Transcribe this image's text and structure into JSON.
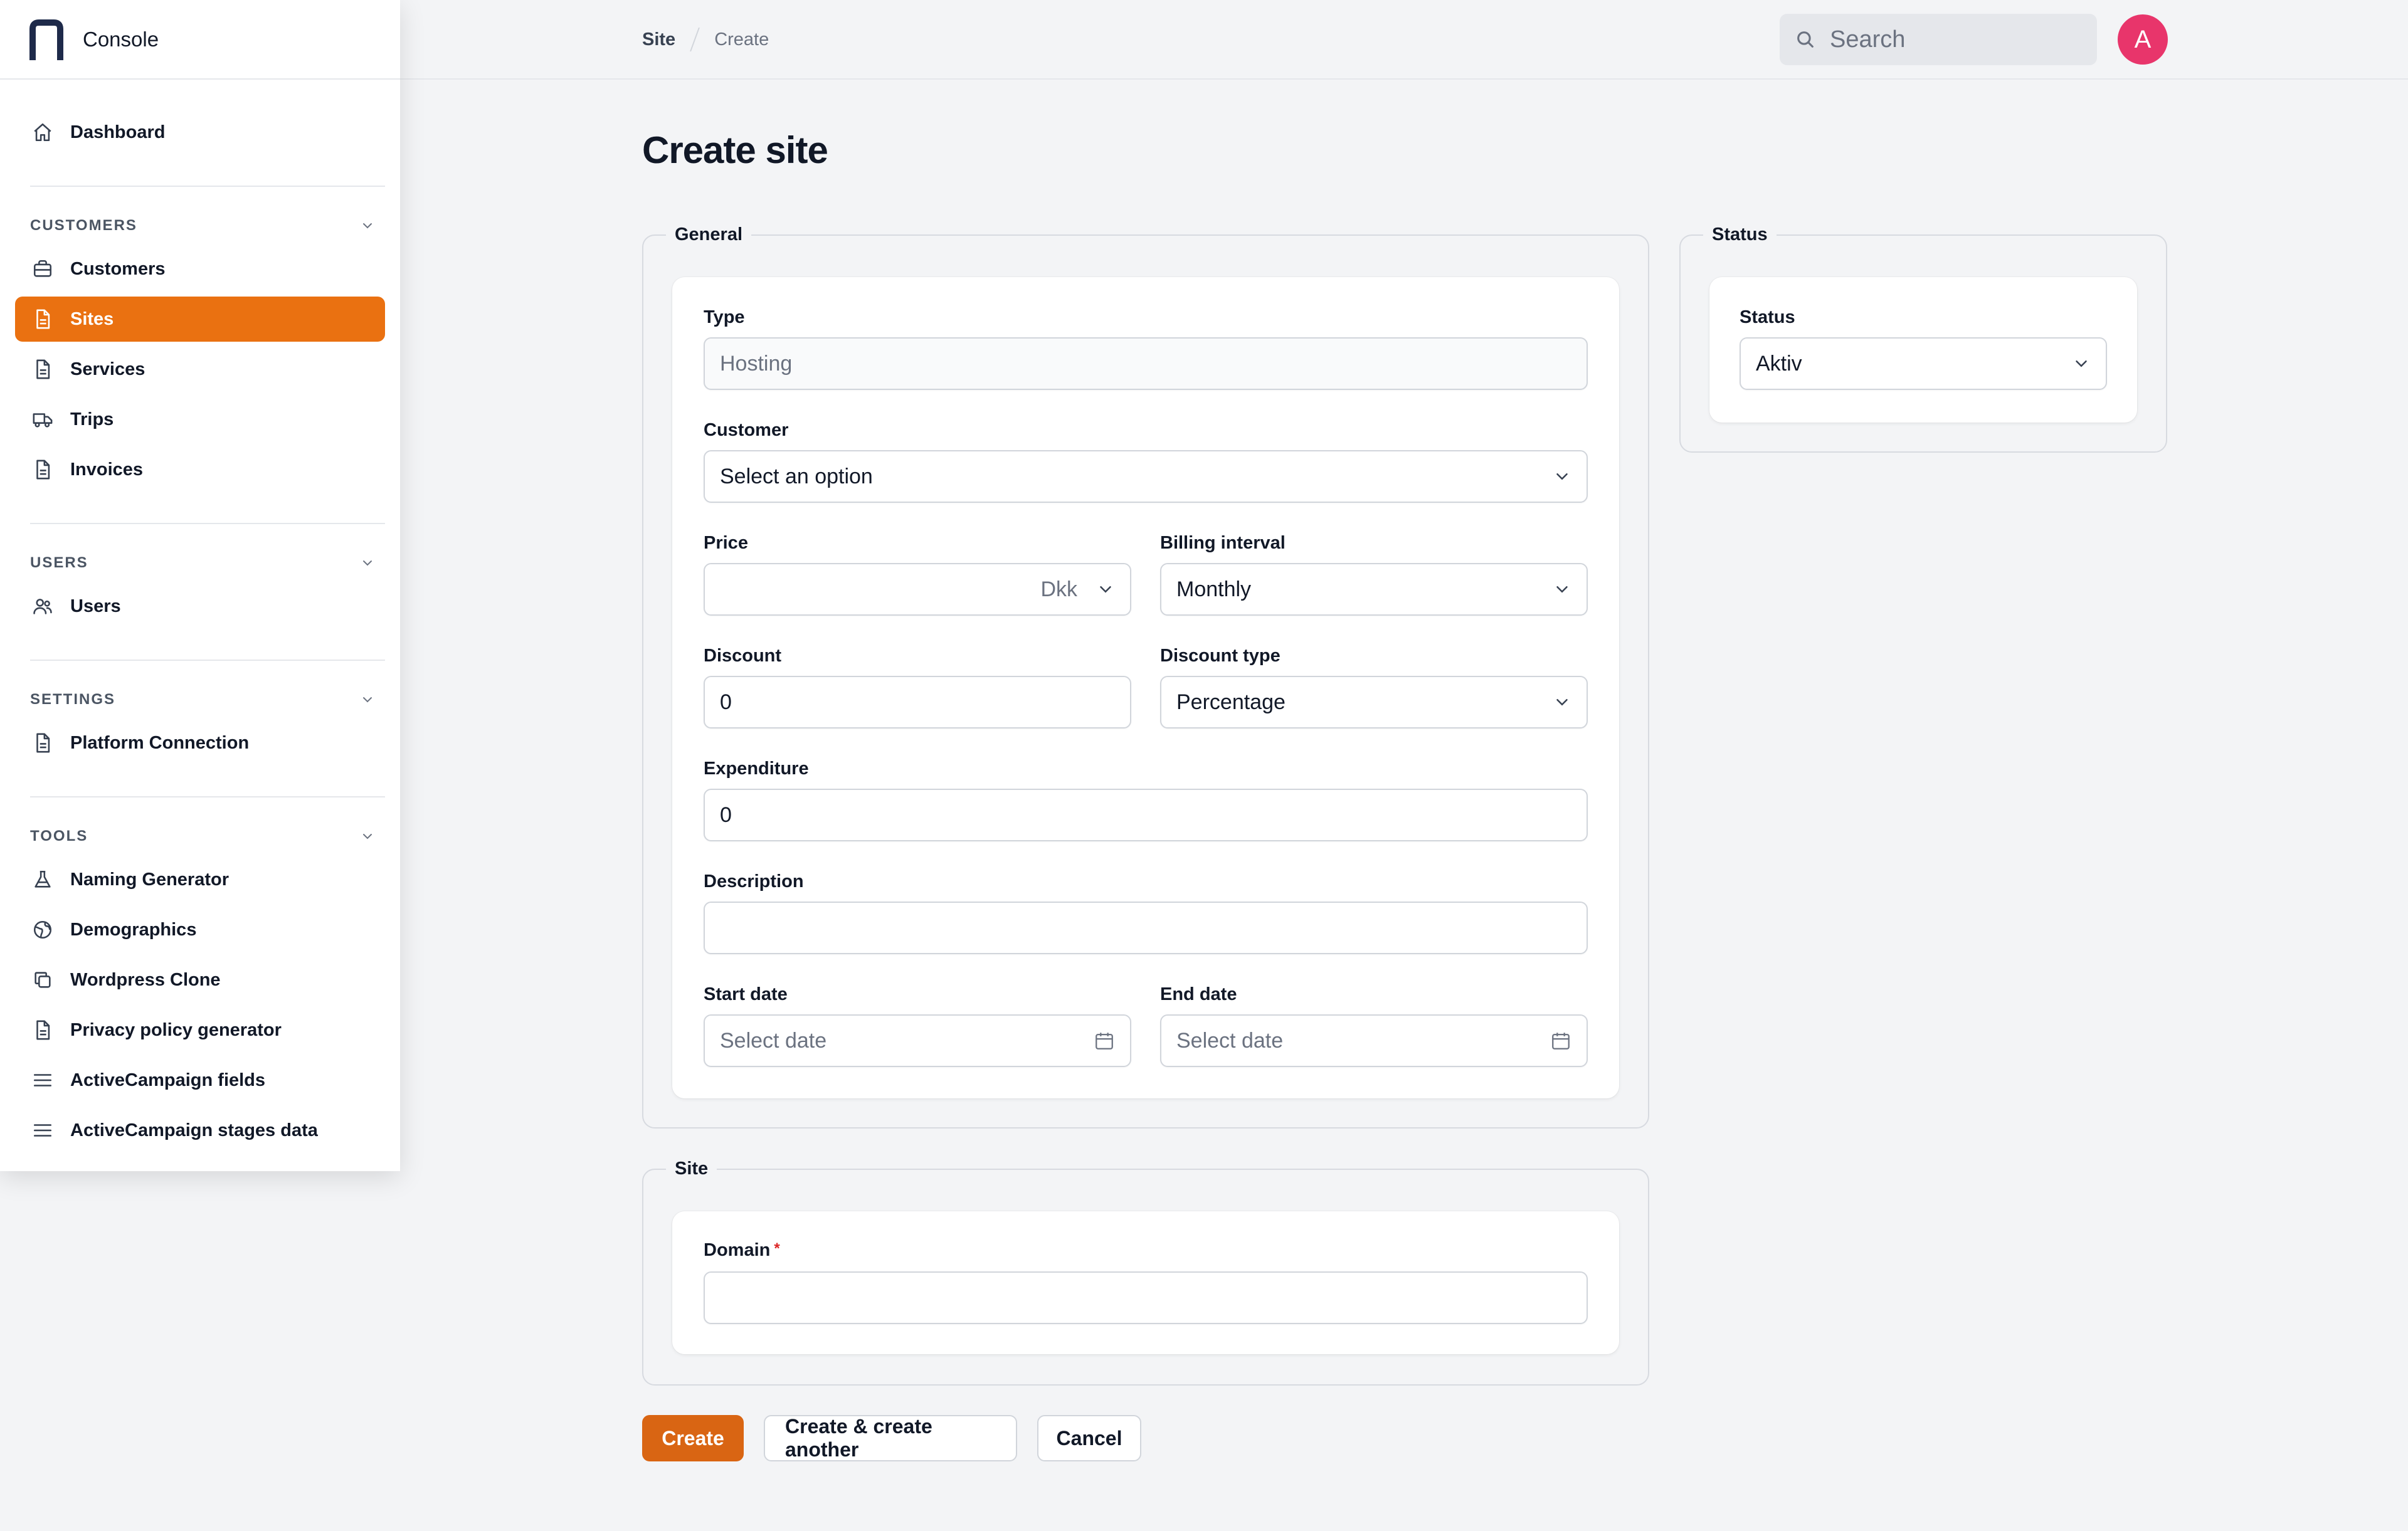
{
  "app": {
    "name": "Console"
  },
  "breadcrumb": [
    "Site",
    "Create"
  ],
  "search": {
    "placeholder": "Search"
  },
  "user": {
    "avatar_initial": "A",
    "avatar_color": "#e8356b"
  },
  "accent_color": "#ea7111",
  "sidebar": {
    "dashboard": "Dashboard",
    "groups": [
      {
        "title": "CUSTOMERS",
        "items": [
          {
            "label": "Customers",
            "icon": "briefcase-icon"
          },
          {
            "label": "Sites",
            "icon": "document-icon",
            "active": true
          },
          {
            "label": "Services",
            "icon": "document-icon"
          },
          {
            "label": "Trips",
            "icon": "truck-icon"
          },
          {
            "label": "Invoices",
            "icon": "document-icon"
          }
        ]
      },
      {
        "title": "USERS",
        "items": [
          {
            "label": "Users",
            "icon": "users-icon"
          }
        ]
      },
      {
        "title": "SETTINGS",
        "items": [
          {
            "label": "Platform Connection",
            "icon": "document-icon"
          }
        ]
      },
      {
        "title": "TOOLS",
        "items": [
          {
            "label": "Naming Generator",
            "icon": "beaker-icon"
          },
          {
            "label": "Demographics",
            "icon": "globe-icon"
          },
          {
            "label": "Wordpress Clone",
            "icon": "copy-icon"
          },
          {
            "label": "Privacy policy generator",
            "icon": "document-icon"
          },
          {
            "label": "ActiveCampaign fields",
            "icon": "list-icon"
          },
          {
            "label": "ActiveCampaign stages data",
            "icon": "list-icon"
          }
        ]
      }
    ]
  },
  "page": {
    "title": "Create site"
  },
  "general": {
    "legend": "General",
    "type": {
      "label": "Type",
      "placeholder": "Hosting"
    },
    "customer": {
      "label": "Customer",
      "value": "Select an option"
    },
    "price": {
      "label": "Price",
      "value": "",
      "currency": "Dkk"
    },
    "billing_interval": {
      "label": "Billing interval",
      "value": "Monthly"
    },
    "discount": {
      "label": "Discount",
      "value": "0"
    },
    "discount_type": {
      "label": "Discount type",
      "value": "Percentage"
    },
    "expenditure": {
      "label": "Expenditure",
      "value": "0"
    },
    "description": {
      "label": "Description",
      "value": ""
    },
    "start_date": {
      "label": "Start date",
      "placeholder": "Select date"
    },
    "end_date": {
      "label": "End date",
      "placeholder": "Select date"
    }
  },
  "status_section": {
    "legend": "Status",
    "status": {
      "label": "Status",
      "value": "Aktiv"
    }
  },
  "site_section": {
    "legend": "Site",
    "domain": {
      "label": "Domain",
      "required_mark": "*",
      "value": ""
    }
  },
  "actions": {
    "create": "Create",
    "create_another": "Create & create another",
    "cancel": "Cancel"
  }
}
